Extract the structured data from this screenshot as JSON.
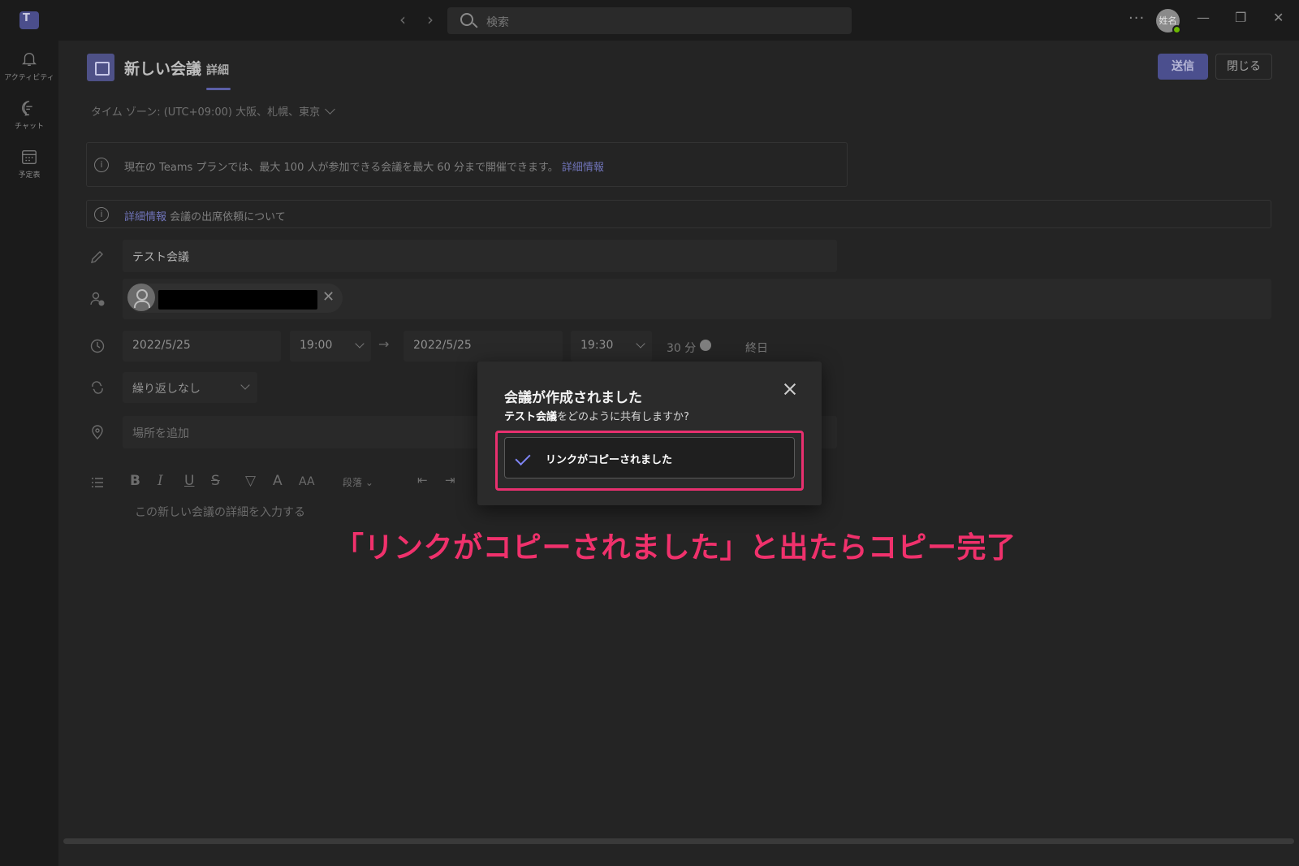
{
  "titlebar": {
    "search_placeholder": "検索",
    "more": "···",
    "avatar_initials": "姓名",
    "minimize": "—",
    "restore": "❐",
    "close": "✕",
    "back": "‹",
    "forward": "›"
  },
  "rail": {
    "items": [
      {
        "label": "アクティビティ",
        "icon": "bell-icon"
      },
      {
        "label": "チャット",
        "icon": "chat-icon"
      },
      {
        "label": "予定表",
        "icon": "calendar-icon"
      }
    ]
  },
  "header": {
    "title": "新しい会議",
    "tab": "詳細",
    "send_label": "送信",
    "close_label": "閉じる"
  },
  "timezone": "タイム ゾーン: (UTC+09:00) 大阪、札幌、東京",
  "banners": {
    "plan_text": "現在の Teams プランでは、最大 100 人が参加できる会議を最大 60 分まで開催できます。",
    "plan_link": "詳細情報",
    "attendance_link": "詳細情報",
    "attendance_text": " 会議の出席依頼について"
  },
  "form": {
    "title_value": "テスト会議",
    "start_date": "2022/5/25",
    "start_time": "19:00",
    "end_date": "2022/5/25",
    "end_time": "19:30",
    "duration": "30 分",
    "all_day_label": "終日",
    "repeat": "繰り返しなし",
    "location_placeholder": "場所を追加",
    "editor_placeholder": "この新しい会議の詳細を入力する",
    "toolbar": {
      "bold": "B",
      "italic": "I",
      "underline": "U",
      "strike": "S",
      "paragraph": "段落"
    }
  },
  "dialog": {
    "title": "会議が作成されました",
    "subtitle_strong": "テスト会議",
    "subtitle_rest": "をどのように共有しますか?",
    "copied_label": "リンクがコピーされました"
  },
  "annotation": "「リンクがコピーされました」と出たらコピー完了",
  "colors": {
    "accent": "#5b5fc7",
    "highlight": "#e8306f",
    "annotation": "#f0316c"
  }
}
